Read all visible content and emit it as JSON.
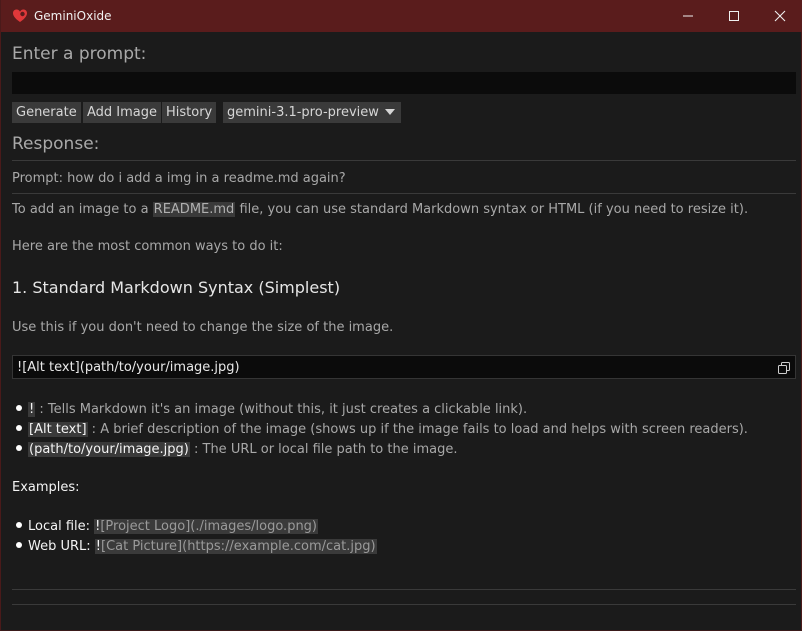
{
  "window": {
    "title": "GeminiOxide",
    "controls": [
      "minimize",
      "maximize",
      "close"
    ]
  },
  "prompt": {
    "heading": "Enter a prompt:",
    "value": "",
    "placeholder": ""
  },
  "toolbar": {
    "generate_label": "Generate",
    "add_image_label": "Add Image",
    "history_label": "History",
    "model_selected": "gemini-3.1-pro-preview"
  },
  "response": {
    "heading": "Response:",
    "prompt_line": "Prompt: how do i add a img in a readme.md again?",
    "intro_before": "To add an image to a ",
    "intro_code": "README.md",
    "intro_after": " file, you can use standard Markdown syntax or HTML (if you need to resize it).",
    "common_ways": "Here are the most common ways to do it:",
    "section_title": "1. Standard Markdown Syntax (Simplest)",
    "section_desc": "Use this if you don't need to change the size of the image.",
    "code_block": "![Alt text](path/to/your/image.jpg)",
    "bullets": [
      {
        "term": "!",
        "desc": " : Tells Markdown it's an image (without this, it just creates a clickable link)."
      },
      {
        "term": "[Alt text]",
        "desc": " : A brief description of the image (shows up if the image fails to load and helps with screen readers)."
      },
      {
        "term": "(path/to/your/image.jpg)",
        "desc": " : The URL or local file path to the image."
      }
    ],
    "examples_heading": "Examples:",
    "examples": [
      {
        "label": "Local file: ",
        "code_bang": "!",
        "code_rest": "[Project Logo](./images/logo.png)"
      },
      {
        "label": "Web URL: ",
        "code_bang": "!",
        "code_rest": "[Cat Picture](https://example.com/cat.jpg)"
      }
    ]
  },
  "colors": {
    "titlebar": "#5a1c1c",
    "background": "#1b1b1b",
    "button": "#3a3a3a",
    "input": "#0b0b0b",
    "icon_red": "#e0383a"
  },
  "icons": [
    "app-heart-icon",
    "minimize-icon",
    "maximize-icon",
    "close-icon",
    "copy-icon",
    "chevron-down-icon"
  ]
}
